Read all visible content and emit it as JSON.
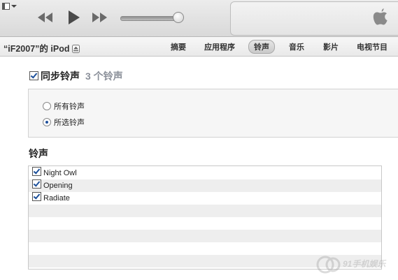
{
  "device": {
    "name": "“iF2007”的 iPod"
  },
  "tabs": [
    {
      "label": "摘要"
    },
    {
      "label": "应用程序"
    },
    {
      "label": "铃声"
    },
    {
      "label": "音乐"
    },
    {
      "label": "影片"
    },
    {
      "label": "电视节目"
    }
  ],
  "active_tab": "铃声",
  "sync": {
    "label": "同步铃声",
    "count": "3 个铃声",
    "checked": true
  },
  "options": [
    {
      "label": "所有铃声",
      "selected": false
    },
    {
      "label": "所选铃声",
      "selected": true
    }
  ],
  "ringtones_section": {
    "title": "铃声"
  },
  "ringtones": [
    {
      "name": "Night Owl",
      "checked": true
    },
    {
      "name": "Opening",
      "checked": true
    },
    {
      "name": "Radiate",
      "checked": true
    }
  ],
  "volume_level": 0.9,
  "watermark": {
    "text": "91手机娱乐"
  }
}
